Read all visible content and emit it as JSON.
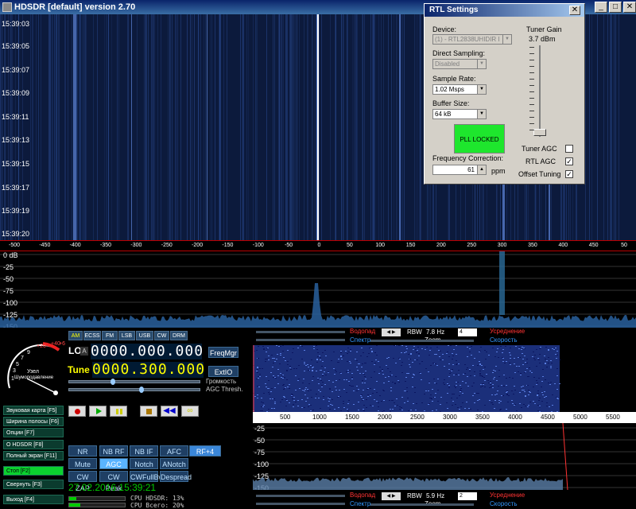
{
  "app": {
    "title": "HDSDR [default]  version 2.70"
  },
  "waterfall": {
    "times": [
      "15:39:03",
      "15:39:05",
      "15:39:07",
      "15:39:09",
      "15:39:11",
      "15:39:13",
      "15:39:15",
      "15:39:17",
      "15:39:19",
      "15:39:20"
    ]
  },
  "ruler": {
    "labels": [
      "-500",
      "-450",
      "-400",
      "-350",
      "-300",
      "-250",
      "-200",
      "-150",
      "-100",
      "-50",
      "0",
      "50",
      "100",
      "150",
      "200",
      "250",
      "300",
      "350",
      "400",
      "450",
      "50"
    ]
  },
  "spectrum": {
    "db_labels": [
      "0 dB",
      "-25",
      "-50",
      "-75",
      "-100",
      "-125",
      "-150"
    ]
  },
  "rtl": {
    "title": "RTL Settings",
    "device_label": "Device:",
    "device_value": "(1) - RTL2838UHIDIR I",
    "direct_sampling_label": "Direct Sampling:",
    "direct_sampling_value": "Disabled",
    "sample_rate_label": "Sample Rate:",
    "sample_rate_value": "1.02 Msps",
    "buffer_size_label": "Buffer Size:",
    "buffer_size_value": "64 kB",
    "pll_status": "PLL LOCKED",
    "freq_corr_label": "Frequency Correction:",
    "freq_corr_value": "61",
    "freq_corr_unit": "ppm",
    "tuner_gain_label": "Tuner Gain",
    "tuner_gain_value": "3.7  dBm",
    "tuner_agc_label": "Tuner AGC",
    "rtl_agc_label": "RTL AGC",
    "offset_tuning_label": "Offset Tuning",
    "pll_color": "#1ee62d"
  },
  "left_buttons": [
    {
      "label": "Звуковая карта [F5]"
    },
    {
      "label": "Ширина полосы [F6]"
    },
    {
      "label": "Опции     [F7]"
    },
    {
      "label": "О   HDSDR   [F8]"
    },
    {
      "label": "Полный экран [F11]"
    },
    {
      "label": "Стоп         [F2]"
    },
    {
      "label": "Свернуть    [F3]"
    },
    {
      "label": "Выход       [F4]"
    }
  ],
  "smeter": {
    "scale": [
      "1",
      "3",
      "5",
      "7",
      "9",
      "+20",
      "+40",
      "+60"
    ],
    "label1": "Узел",
    "label2": "Шумоподавление"
  },
  "modes": [
    "AM",
    "ECSS",
    "FM",
    "LSB",
    "USB",
    "CW",
    "DRM"
  ],
  "lo": {
    "label": "LO",
    "a": "A",
    "value": "0000.000.000",
    "btn": "FreqMgr"
  },
  "tune": {
    "label": "Tune",
    "value": "0000.300.000",
    "btn": "ExtIO"
  },
  "volume_label": "Громкость",
  "agc_label": "AGC Thresh.",
  "dsp_row1": [
    "NR",
    "NB RF",
    "NB IF",
    "AFC",
    "RF+4"
  ],
  "dsp_row2": [
    "Mute",
    "AGC Slow",
    "Notch",
    "ANotch"
  ],
  "dsp_row3": [
    "CW ZAP",
    "CW Peak",
    "CWFullBw",
    "Despread"
  ],
  "datetime": "27.02.2016 15:39:21",
  "cpu1": "CPU HDSDR: 13%",
  "cpu2": "CPU Всего: 20%",
  "af_top": {
    "waterfall": "Водопад",
    "spectrum": "Спектр",
    "rbw_label": "RBW",
    "rbw_value": "7.8 Hz",
    "speed_value": "4",
    "avg": "Усреднение",
    "speed": "Скорость",
    "zoom": "Zoom"
  },
  "af_ruler": [
    "500",
    "1000",
    "1500",
    "2000",
    "2500",
    "3000",
    "3500",
    "4000",
    "4500",
    "5000",
    "5500"
  ],
  "af_db": [
    "-25",
    "-50",
    "-75",
    "-100",
    "-125",
    "-150"
  ],
  "af_bottom": {
    "waterfall": "Водопад",
    "spectrum": "Спектр",
    "rbw_label": "RBW",
    "rbw_value": "5.9 Hz",
    "speed_value": "2",
    "avg": "Усреднение",
    "speed": "Скорость",
    "zoom": "Zoom"
  }
}
